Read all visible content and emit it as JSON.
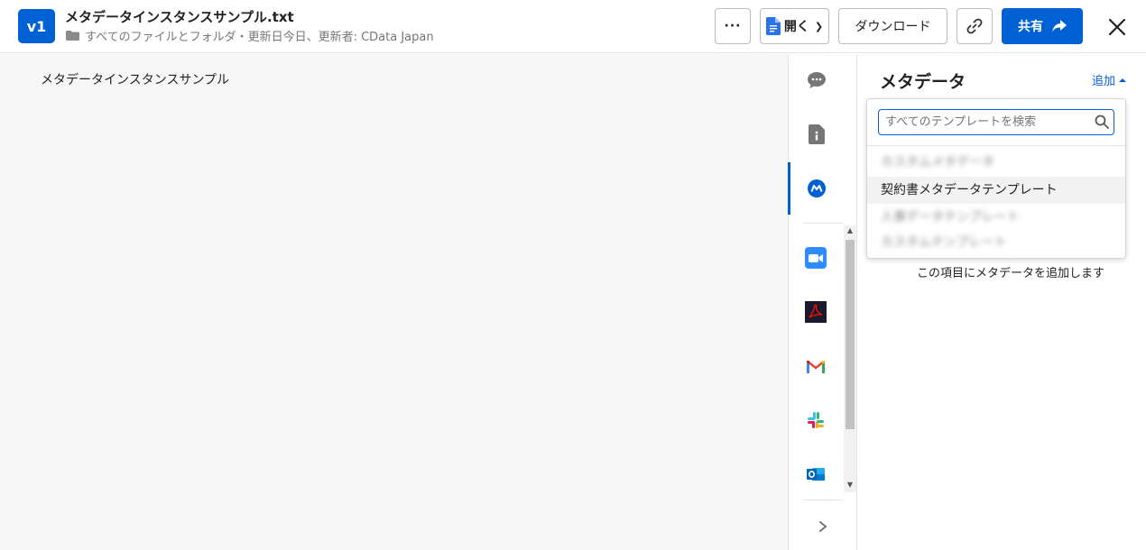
{
  "header": {
    "version_badge": "v1",
    "file_name": "メタデータインスタンスサンプル.txt",
    "breadcrumb": "すべてのファイルとフォルダ・更新日今日、更新者: CData Japan",
    "more_label": "···",
    "open_label": "開く",
    "download_label": "ダウンロード",
    "share_label": "共有"
  },
  "preview": {
    "content": "メタデータインスタンスサンプル"
  },
  "panel": {
    "title": "メタデータ",
    "add_label": "追加",
    "empty_message": "この項目にメタデータを追加します"
  },
  "dropdown": {
    "search_placeholder": "すべてのテンプレートを検索",
    "items": [
      {
        "label": "カスタムメタデータ",
        "blurred": true
      },
      {
        "label": "契約書メタデータテンプレート",
        "blurred": false
      },
      {
        "label": "人事データテンプレート",
        "blurred": true
      },
      {
        "label": "カスタムテンプレート",
        "blurred": true
      }
    ]
  },
  "colors": {
    "accent": "#0061d5"
  }
}
